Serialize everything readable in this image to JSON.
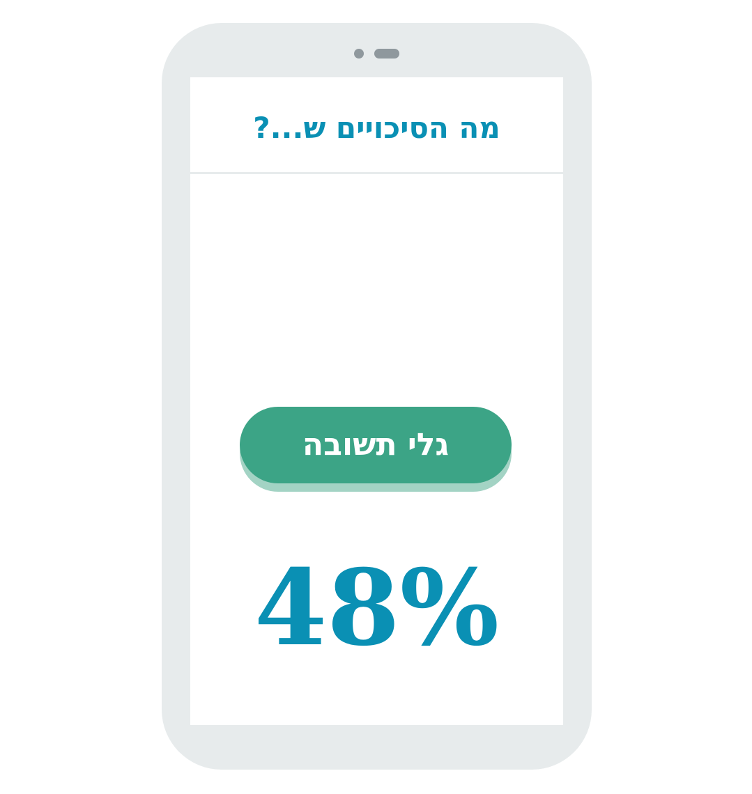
{
  "question": {
    "text": "מה הסיכויים ש...?"
  },
  "reveal_button": {
    "label": "גלי תשובה"
  },
  "answer": {
    "value": "48%"
  },
  "colors": {
    "accent": "#0a90b4",
    "button": "#3ca486",
    "button_shadow": "#a3d3c4",
    "device_frame": "#e7ebec",
    "device_details": "#8f989d"
  }
}
